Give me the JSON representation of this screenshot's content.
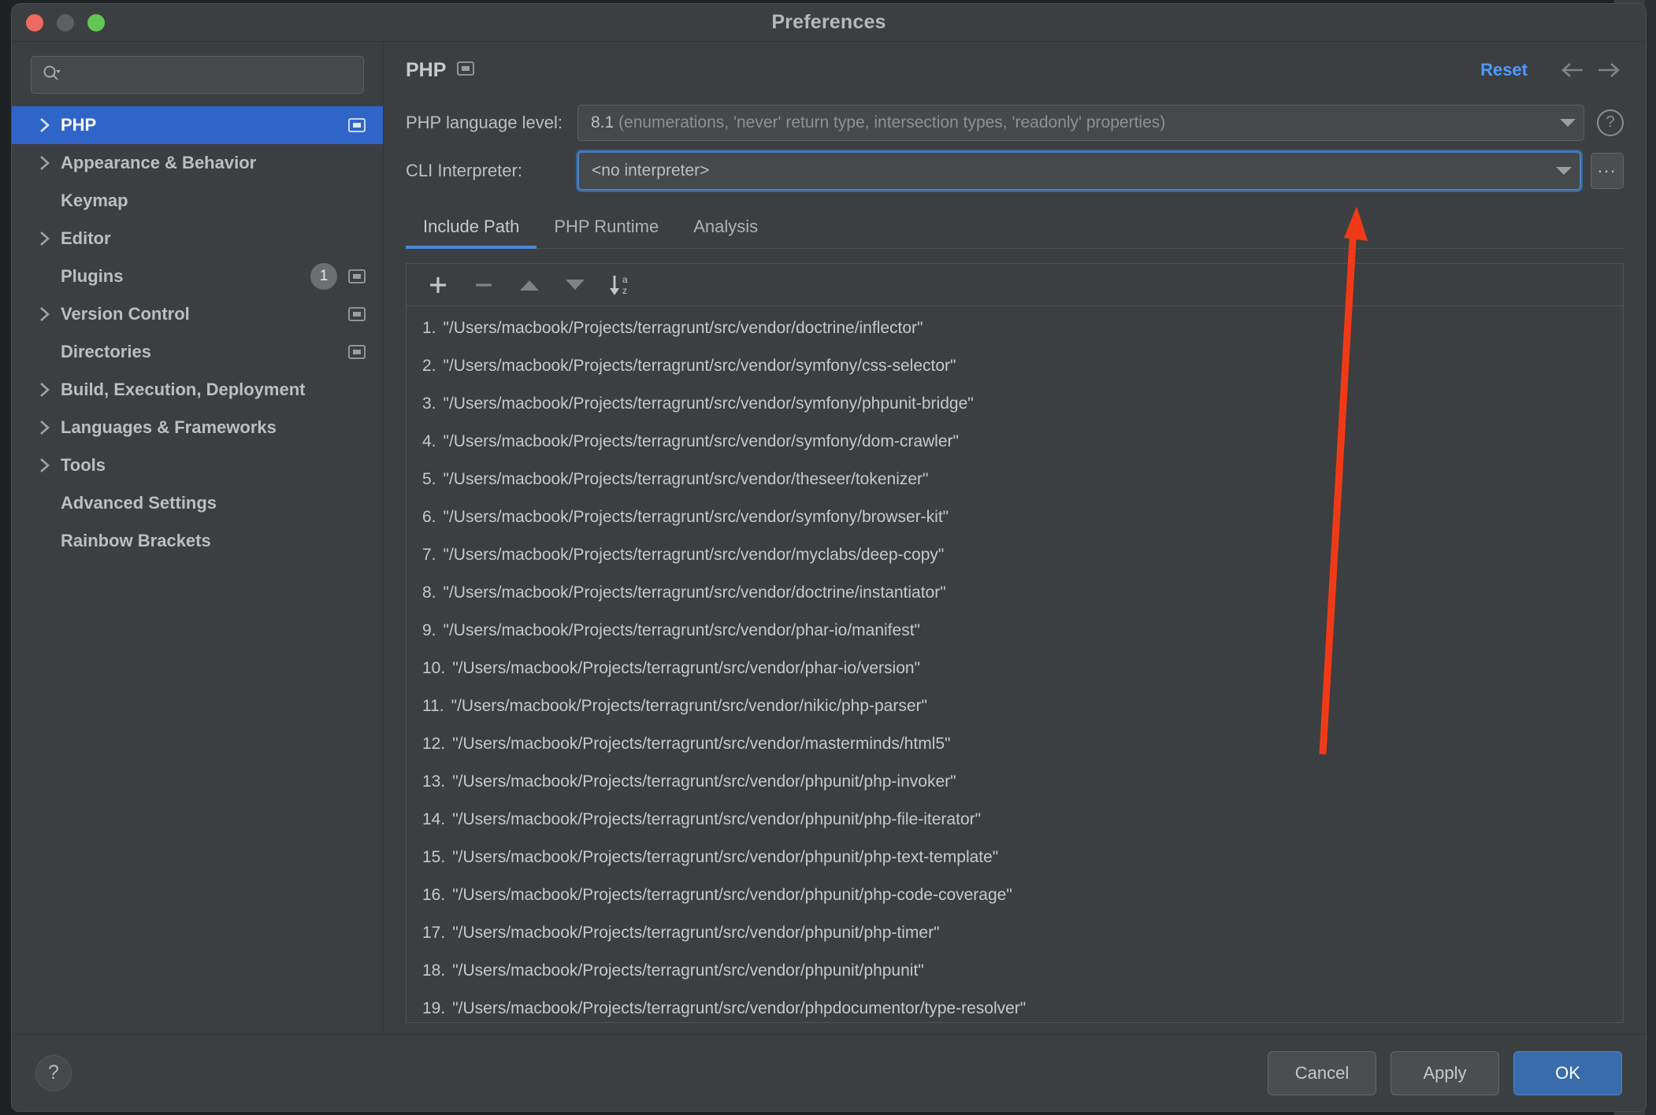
{
  "window": {
    "title": "Preferences",
    "traffic_lights": [
      "close",
      "minimize",
      "maximize"
    ]
  },
  "sidebar": {
    "search": {
      "value": "",
      "placeholder": ""
    },
    "items": [
      {
        "label": "PHP",
        "expandable": true,
        "selected": true,
        "project_icon": true,
        "badge": null
      },
      {
        "label": "Appearance & Behavior",
        "expandable": true,
        "selected": false,
        "project_icon": false,
        "badge": null
      },
      {
        "label": "Keymap",
        "expandable": false,
        "selected": false,
        "project_icon": false,
        "badge": null
      },
      {
        "label": "Editor",
        "expandable": true,
        "selected": false,
        "project_icon": false,
        "badge": null
      },
      {
        "label": "Plugins",
        "expandable": false,
        "selected": false,
        "project_icon": true,
        "badge": "1"
      },
      {
        "label": "Version Control",
        "expandable": true,
        "selected": false,
        "project_icon": true,
        "badge": null
      },
      {
        "label": "Directories",
        "expandable": false,
        "selected": false,
        "project_icon": true,
        "badge": null
      },
      {
        "label": "Build, Execution, Deployment",
        "expandable": true,
        "selected": false,
        "project_icon": false,
        "badge": null
      },
      {
        "label": "Languages & Frameworks",
        "expandable": true,
        "selected": false,
        "project_icon": false,
        "badge": null
      },
      {
        "label": "Tools",
        "expandable": true,
        "selected": false,
        "project_icon": false,
        "badge": null
      },
      {
        "label": "Advanced Settings",
        "expandable": false,
        "selected": false,
        "project_icon": false,
        "badge": null
      },
      {
        "label": "Rainbow Brackets",
        "expandable": false,
        "selected": false,
        "project_icon": false,
        "badge": null
      }
    ]
  },
  "main": {
    "page_title": "PHP",
    "reset_label": "Reset",
    "language_level": {
      "label": "PHP language level:",
      "value": "8.1",
      "value_detail": "(enumerations, 'never' return type, intersection types, 'readonly' properties)"
    },
    "cli_interpreter": {
      "label": "CLI Interpreter:",
      "value": "<no interpreter>",
      "browse_label": "..."
    },
    "tabs": [
      {
        "label": "Include Path",
        "active": true
      },
      {
        "label": "PHP Runtime",
        "active": false
      },
      {
        "label": "Analysis",
        "active": false
      }
    ],
    "list_toolbar": [
      {
        "name": "add",
        "glyph": "+"
      },
      {
        "name": "remove",
        "glyph": "−"
      },
      {
        "name": "move-up",
        "glyph": "▲"
      },
      {
        "name": "move-down",
        "glyph": "▼"
      },
      {
        "name": "sort-alpha",
        "glyph": "az"
      }
    ],
    "include_paths": [
      {
        "num": "1.",
        "path": "\"/Users/macbook/Projects/terragrunt/src/vendor/doctrine/inflector\""
      },
      {
        "num": "2.",
        "path": "\"/Users/macbook/Projects/terragrunt/src/vendor/symfony/css-selector\""
      },
      {
        "num": "3.",
        "path": "\"/Users/macbook/Projects/terragrunt/src/vendor/symfony/phpunit-bridge\""
      },
      {
        "num": "4.",
        "path": "\"/Users/macbook/Projects/terragrunt/src/vendor/symfony/dom-crawler\""
      },
      {
        "num": "5.",
        "path": "\"/Users/macbook/Projects/terragrunt/src/vendor/theseer/tokenizer\""
      },
      {
        "num": "6.",
        "path": "\"/Users/macbook/Projects/terragrunt/src/vendor/symfony/browser-kit\""
      },
      {
        "num": "7.",
        "path": "\"/Users/macbook/Projects/terragrunt/src/vendor/myclabs/deep-copy\""
      },
      {
        "num": "8.",
        "path": "\"/Users/macbook/Projects/terragrunt/src/vendor/doctrine/instantiator\""
      },
      {
        "num": "9.",
        "path": "\"/Users/macbook/Projects/terragrunt/src/vendor/phar-io/manifest\""
      },
      {
        "num": "10.",
        "path": "\"/Users/macbook/Projects/terragrunt/src/vendor/phar-io/version\""
      },
      {
        "num": "11.",
        "path": "\"/Users/macbook/Projects/terragrunt/src/vendor/nikic/php-parser\""
      },
      {
        "num": "12.",
        "path": "\"/Users/macbook/Projects/terragrunt/src/vendor/masterminds/html5\""
      },
      {
        "num": "13.",
        "path": "\"/Users/macbook/Projects/terragrunt/src/vendor/phpunit/php-invoker\""
      },
      {
        "num": "14.",
        "path": "\"/Users/macbook/Projects/terragrunt/src/vendor/phpunit/php-file-iterator\""
      },
      {
        "num": "15.",
        "path": "\"/Users/macbook/Projects/terragrunt/src/vendor/phpunit/php-text-template\""
      },
      {
        "num": "16.",
        "path": "\"/Users/macbook/Projects/terragrunt/src/vendor/phpunit/php-code-coverage\""
      },
      {
        "num": "17.",
        "path": "\"/Users/macbook/Projects/terragrunt/src/vendor/phpunit/php-timer\""
      },
      {
        "num": "18.",
        "path": "\"/Users/macbook/Projects/terragrunt/src/vendor/phpunit/phpunit\""
      },
      {
        "num": "19.",
        "path": "\"/Users/macbook/Projects/terragrunt/src/vendor/phpdocumentor/type-resolver\""
      }
    ]
  },
  "footer": {
    "help_label": "?",
    "cancel_label": "Cancel",
    "apply_label": "Apply",
    "ok_label": "OK"
  },
  "annotation": {
    "arrow_color": "#F03A17"
  },
  "colors": {
    "accent_blue": "#2f65c9",
    "link_blue": "#4d9aff",
    "tab_underline": "#4a88d4",
    "window_bg": "#3c3f41",
    "primary_button": "#386cab"
  }
}
